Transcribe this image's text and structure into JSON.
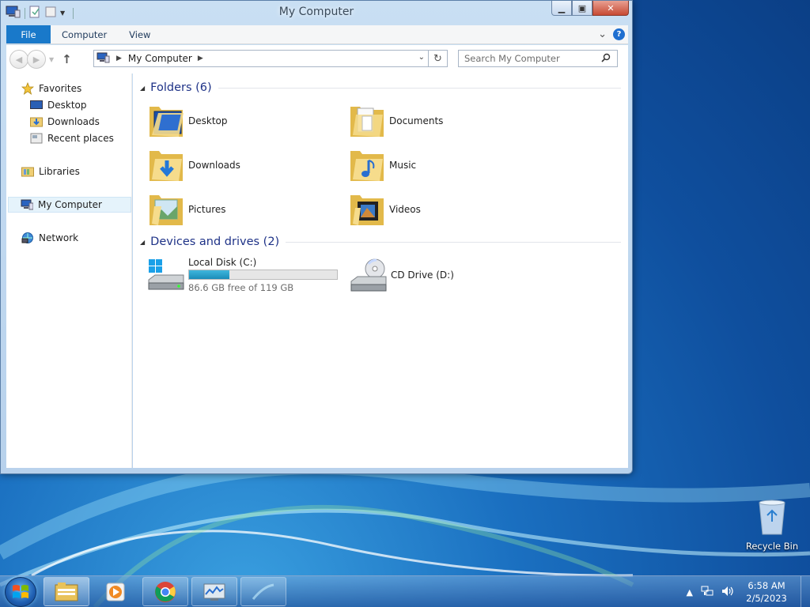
{
  "window": {
    "title": "My Computer"
  },
  "ribbon": {
    "tabs": [
      {
        "label": "File"
      },
      {
        "label": "Computer"
      },
      {
        "label": "View"
      }
    ],
    "collapse_glyph": "⌄",
    "help_glyph": "?"
  },
  "navbar": {
    "address_crumb": "My Computer",
    "search_placeholder": "Search My Computer"
  },
  "nav_pane": {
    "favorites": {
      "label": "Favorites",
      "icon": "star-icon"
    },
    "favorite_items": [
      {
        "label": "Desktop",
        "icon": "desktop-icon"
      },
      {
        "label": "Downloads",
        "icon": "downloads-icon"
      },
      {
        "label": "Recent places",
        "icon": "recent-places-icon"
      }
    ],
    "libraries": {
      "label": "Libraries",
      "icon": "libraries-icon"
    },
    "my_computer": {
      "label": "My Computer",
      "icon": "computer-icon",
      "selected": true
    },
    "network": {
      "label": "Network",
      "icon": "network-icon"
    }
  },
  "content": {
    "folders_header": "Folders (6)",
    "folders": [
      {
        "label": "Desktop",
        "icon": "desktop-folder-icon"
      },
      {
        "label": "Documents",
        "icon": "documents-folder-icon"
      },
      {
        "label": "Downloads",
        "icon": "downloads-folder-icon"
      },
      {
        "label": "Music",
        "icon": "music-folder-icon"
      },
      {
        "label": "Pictures",
        "icon": "pictures-folder-icon"
      },
      {
        "label": "Videos",
        "icon": "videos-folder-icon"
      }
    ],
    "devices_header": "Devices and drives (2)",
    "drives": [
      {
        "label": "Local Disk (C:)",
        "free_text": "86.6 GB free of 119 GB",
        "used_fraction": 0.272,
        "icon": "local-disk-icon"
      },
      {
        "label": "CD Drive (D:)",
        "icon": "cd-drive-icon"
      }
    ]
  },
  "desktop": {
    "recycle_bin": "Recycle Bin"
  },
  "taskbar": {
    "time": "6:58 AM",
    "date": "2/5/2023",
    "pinned": [
      "file-explorer-icon",
      "media-player-icon",
      "chrome-icon",
      "resource-monitor-icon",
      "blank-window-icon"
    ]
  },
  "colors": {
    "accent": "#1979ca",
    "group_header": "#1e3287",
    "usage_bar": "#26a0c9"
  }
}
